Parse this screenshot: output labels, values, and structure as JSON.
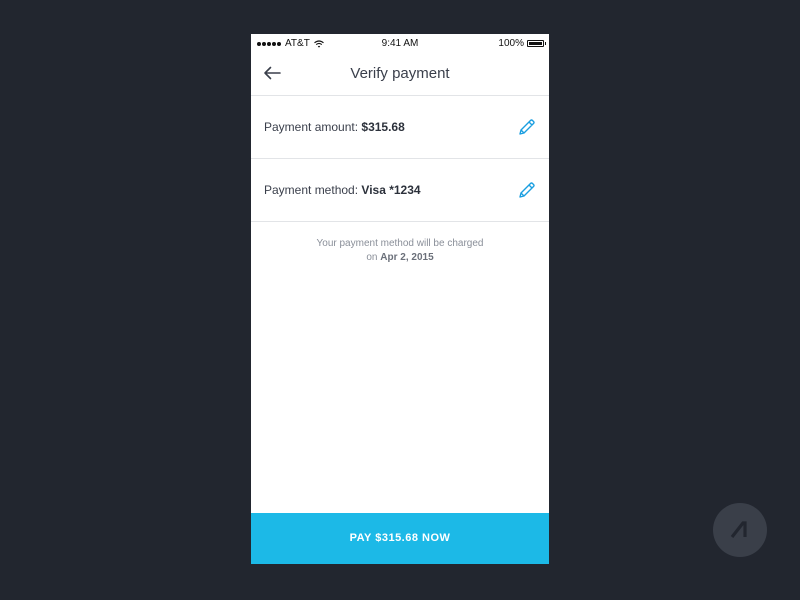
{
  "status_bar": {
    "carrier": "AT&T",
    "time": "9:41 AM",
    "battery": "100%"
  },
  "nav": {
    "title": "Verify payment"
  },
  "payment_amount": {
    "label": "Payment amount:",
    "value": "$315.68"
  },
  "payment_method": {
    "label": "Payment method:",
    "value": "Visa *1234"
  },
  "notice": {
    "line1": "Your payment method will be charged",
    "prefix": "on",
    "date": "Apr 2, 2015"
  },
  "pay_button": {
    "label": "PAY $315.68 NOW"
  },
  "colors": {
    "background": "#22262f",
    "accent": "#1cb9e7",
    "edit_icon": "#1a9ee0"
  },
  "icons": [
    "signal-dots-icon",
    "wifi-icon",
    "battery-icon",
    "back-arrow-icon",
    "pencil-icon",
    "brand-logo-icon"
  ]
}
